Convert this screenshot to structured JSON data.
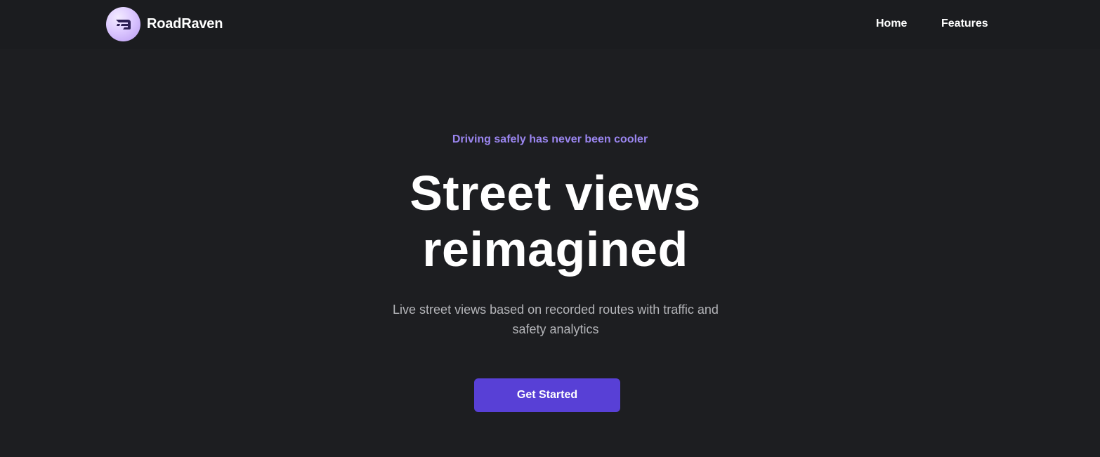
{
  "brand": {
    "name": "RoadRaven",
    "logo_icon": "winged-raven-logo-icon"
  },
  "nav": {
    "items": [
      {
        "label": "Home"
      },
      {
        "label": "Features"
      }
    ]
  },
  "hero": {
    "tagline": "Driving safely has never been cooler",
    "headline_line1": "Street views",
    "headline_line2": "reimagined",
    "subtitle": "Live street views based on recorded routes with traffic and safety analytics",
    "cta_label": "Get Started"
  },
  "colors": {
    "background": "#1d1e21",
    "accent": "#5840d6",
    "tagline": "#9b86f0"
  }
}
